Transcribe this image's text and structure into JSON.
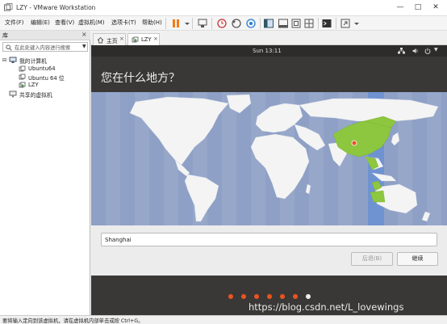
{
  "window": {
    "title": "LZY - VMware Workstation"
  },
  "menu": [
    "文件(F)",
    "编辑(E)",
    "查看(V)",
    "虚拟机(M)",
    "选项卡(T)",
    "帮助(H)"
  ],
  "library": {
    "title": "库",
    "close": "×",
    "search_placeholder": "在此处键入内容进行搜索",
    "tree": {
      "root": "我的计算机",
      "vms": [
        "Ubuntu64",
        "Ubuntu 64 位",
        "LZY"
      ],
      "shared": "共享的虚拟机"
    }
  },
  "tabs": [
    {
      "label": "主页",
      "active": false
    },
    {
      "label": "LZY",
      "active": true
    }
  ],
  "guest": {
    "clock": "Sun 13:11",
    "heading": "您在什么地方？",
    "city_value": "Shanghai",
    "back_button": "后退(B)",
    "continue_button": "继续",
    "progress_dots_total": 7,
    "progress_dots_done": 6
  },
  "watermark": "https://blog.csdn.net/L_lovewings",
  "statusbar": {
    "text": "要将输入定向到该虚拟机，请在虚拟机内部单击或按 Ctrl+G。"
  },
  "colors": {
    "accent_orange": "#e95420",
    "pause_orange": "#f07a1a",
    "map_ocean": "#8ea0c5",
    "selected_zone": "#6f93d1",
    "selected_country": "#8dc63f"
  }
}
